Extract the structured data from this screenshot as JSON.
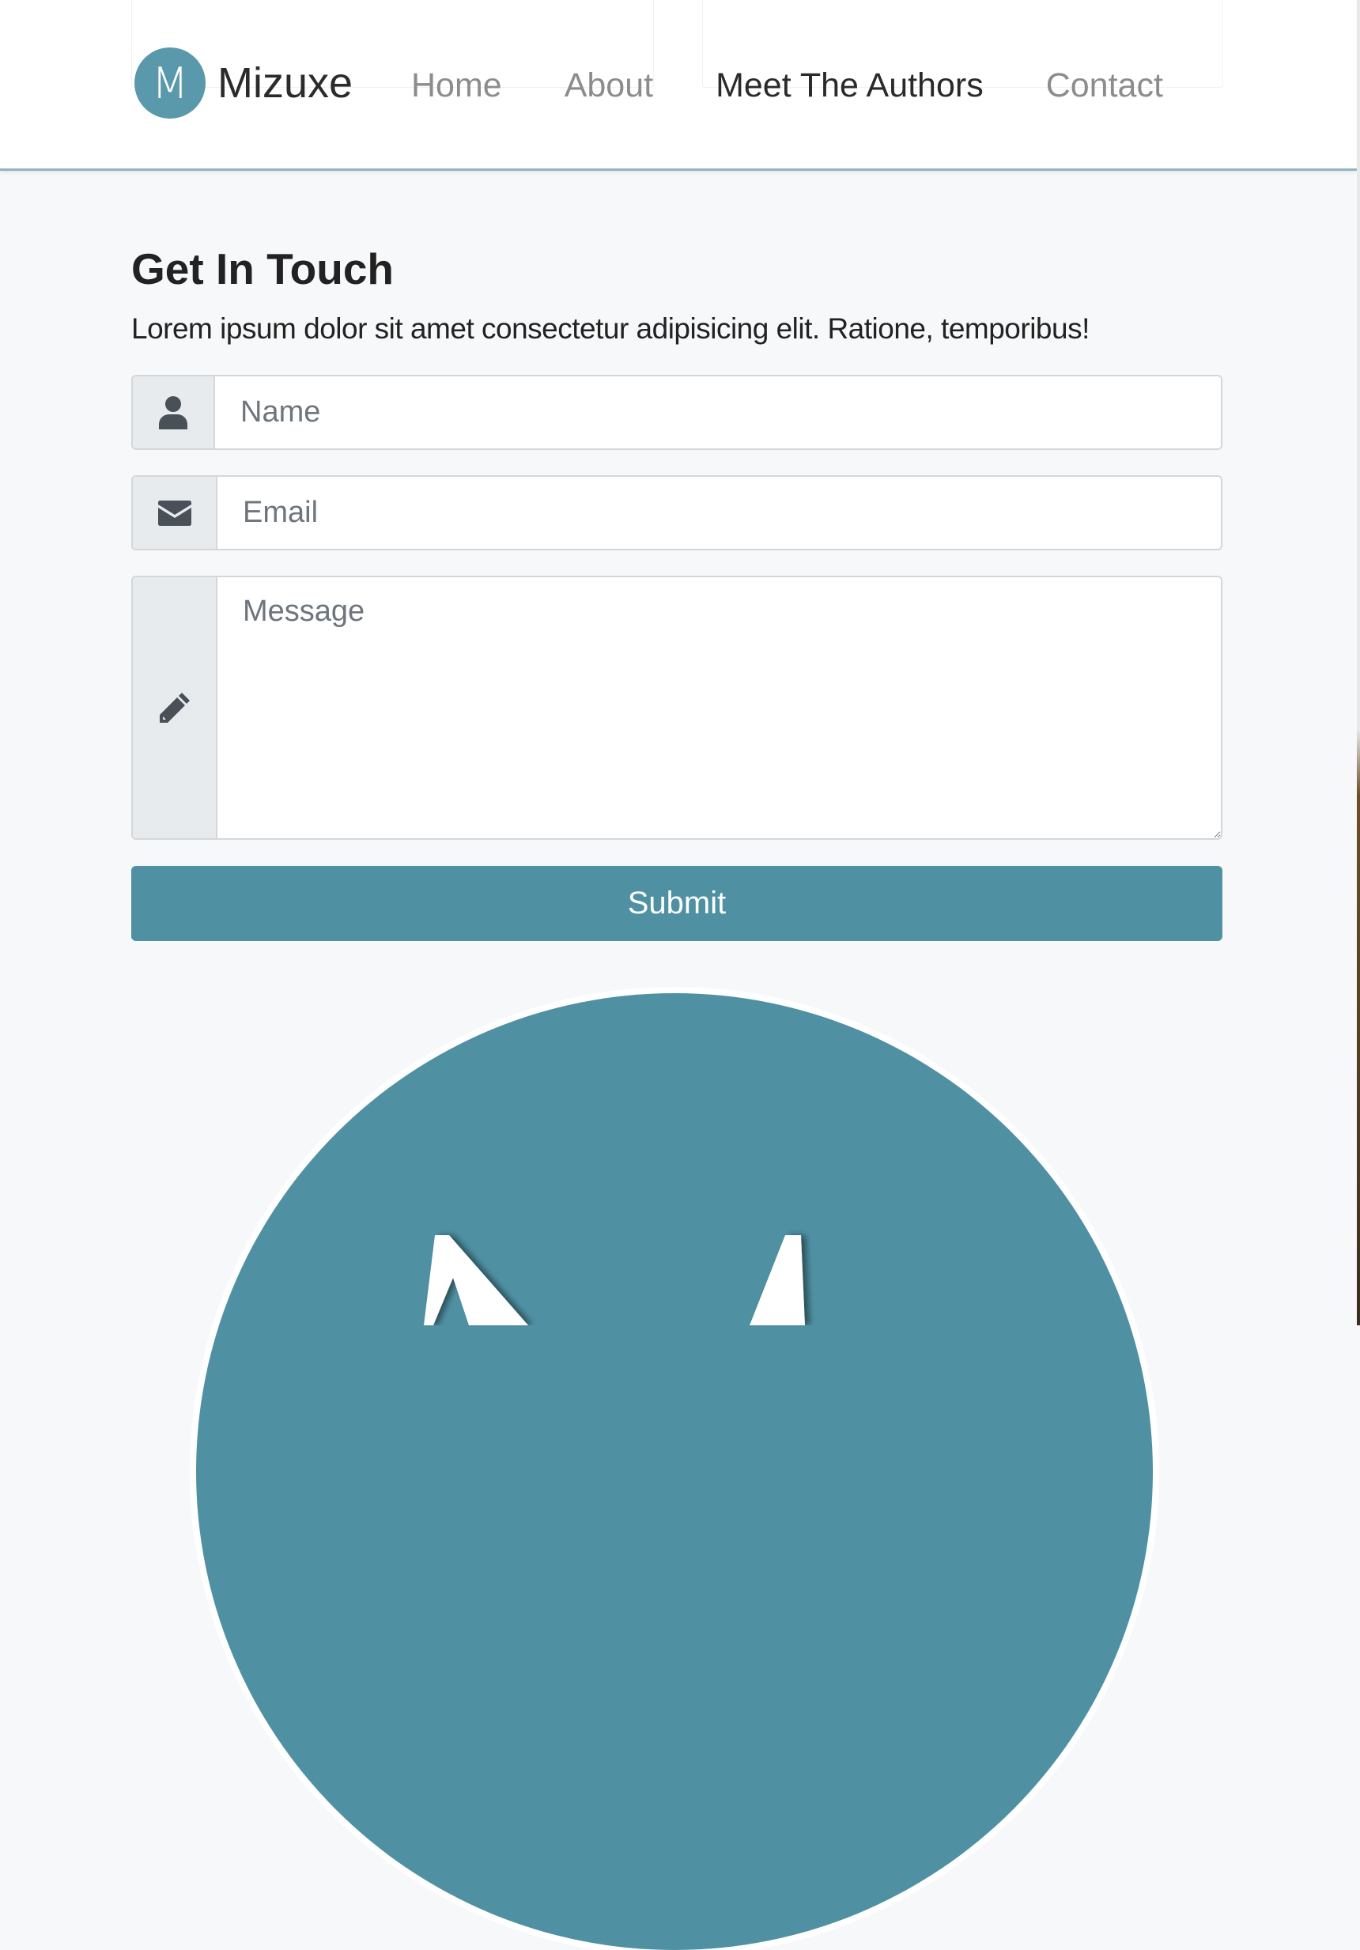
{
  "brand": {
    "logo_letter": "M",
    "name": "Mizuxe"
  },
  "nav": {
    "items": [
      {
        "label": "Home",
        "active": false
      },
      {
        "label": "About",
        "active": false
      },
      {
        "label": "Meet The Authors",
        "active": true
      },
      {
        "label": "Contact",
        "active": false
      }
    ]
  },
  "contact": {
    "heading": "Get In Touch",
    "lead": "Lorem ipsum dolor sit amet consectetur adipisicing elit. Ratione, temporibus!",
    "name_placeholder": "Name",
    "email_placeholder": "Email",
    "message_placeholder": "Message",
    "name_icon": "user-icon",
    "email_icon": "envelope-icon",
    "message_icon": "pencil-icon",
    "submit_label": "Submit"
  },
  "colors": {
    "accent": "#4f91a3",
    "logo": "#5a99ab",
    "nav_active": "#2a2a2a",
    "nav_inactive": "#8c8c8c",
    "page_bg": "#f7f8f9"
  }
}
